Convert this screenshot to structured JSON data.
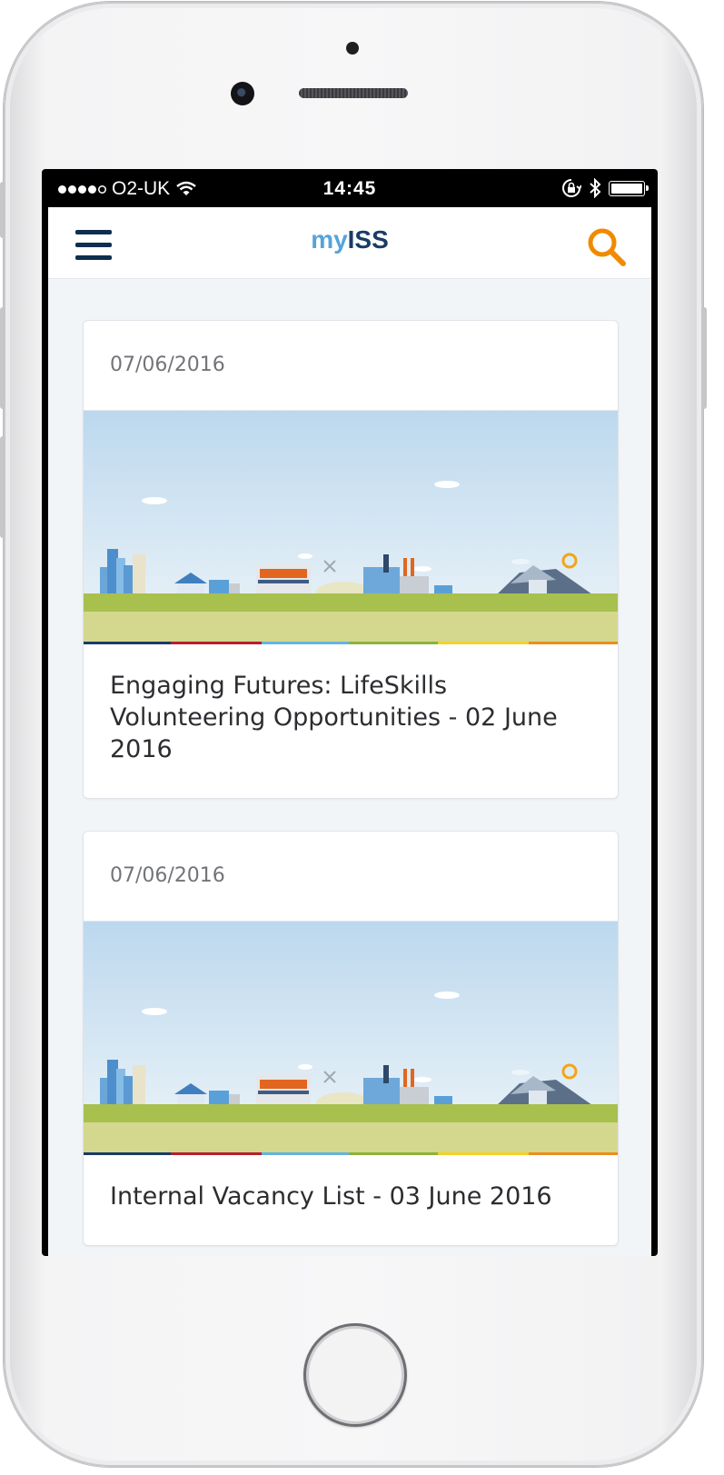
{
  "status_bar": {
    "carrier": "O2-UK",
    "time": "14:45"
  },
  "app_bar": {
    "logo_prefix": "my",
    "logo_suffix": "ISS"
  },
  "colors": {
    "brand_dark": "#1a3c66",
    "brand_light": "#55a4db",
    "search_accent": "#f08a00"
  },
  "news": [
    {
      "date": "07/06/2016",
      "title": "Engaging Futures: LifeSkills Volunteering Opportunities - 02 June 2016"
    },
    {
      "date": "07/06/2016",
      "title": "Internal Vacancy List - 03 June 2016"
    }
  ]
}
